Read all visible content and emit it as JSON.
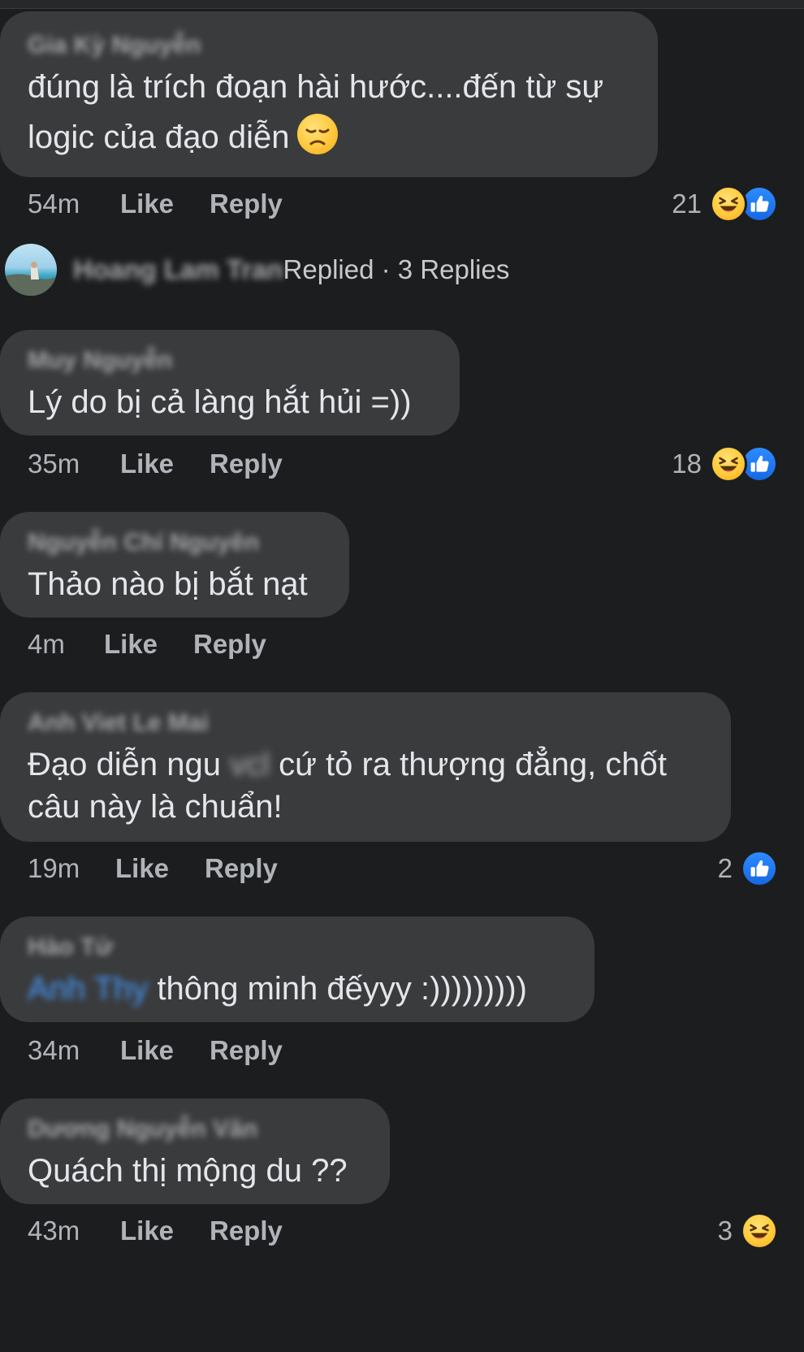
{
  "comments": [
    {
      "author": "Gia Kỳ Nguyễn",
      "text_lines": [
        "đúng là trích đoạn hài hước....đến từ sự",
        "logic của đạo diễn"
      ],
      "time": "54m",
      "like_label": "Like",
      "reply_label": "Reply",
      "reaction_count": "21",
      "reactions": [
        "haha-icon",
        "like-icon"
      ]
    },
    {
      "author": "Muy Nguyễn",
      "text": "Lý do bị cả làng hắt hủi =))",
      "time": "35m",
      "like_label": "Like",
      "reply_label": "Reply",
      "reaction_count": "18",
      "reactions": [
        "haha-icon",
        "like-icon"
      ]
    },
    {
      "author": "Nguyễn Chí Nguyên",
      "text": "Thảo nào bị bắt nạt",
      "time": "4m",
      "like_label": "Like",
      "reply_label": "Reply"
    },
    {
      "author": "Anh Viet Le Mai",
      "text_part1": "Đạo diễn ngu",
      "text_censored": "vcl",
      "text_part2": "cứ tỏ ra thượng đẳng, chốt",
      "text_line2": "câu này là chuẩn!",
      "time": "19m",
      "like_label": "Like",
      "reply_label": "Reply",
      "reaction_count": "2",
      "reactions": [
        "like-icon"
      ]
    },
    {
      "author": "Hào Tử",
      "mention": "Anh Thy",
      "text": "thông minh đếyyy :)))))))))",
      "time": "34m",
      "like_label": "Like",
      "reply_label": "Reply"
    },
    {
      "author": "Dương Nguyễn Văn",
      "text": "Quách thị mộng du ??",
      "time": "43m",
      "like_label": "Like",
      "reply_label": "Reply",
      "reaction_count": "3",
      "reactions": [
        "haha-icon"
      ]
    }
  ],
  "replied": {
    "name": "Hoang Lam Tran",
    "label": "Replied · 3 Replies"
  },
  "colors": {
    "background": "#1c1d1f",
    "bubble": "#3a3b3c",
    "text": "#e4e6eb",
    "muted": "#b0b3b8",
    "like_blue": "#1877f2",
    "haha_yellow": "#ffcb3a"
  }
}
